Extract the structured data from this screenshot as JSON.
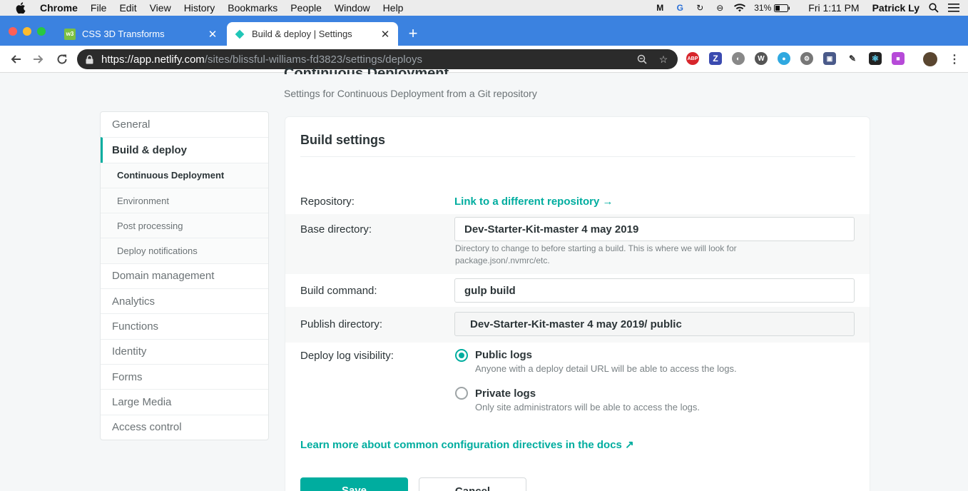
{
  "menubar": {
    "app": "Chrome",
    "items": [
      "File",
      "Edit",
      "View",
      "History",
      "Bookmarks",
      "People",
      "Window",
      "Help"
    ],
    "battery": "31%",
    "clock": "Fri 1:11 PM",
    "user": "Patrick Ly"
  },
  "tabs": [
    {
      "title": "CSS 3D Transforms"
    },
    {
      "title": "Build & deploy | Settings"
    }
  ],
  "address": {
    "scheme": "https://",
    "host": "app.netlify.com",
    "path": "/sites/blissful-williams-fd3823/settings/deploys"
  },
  "page": {
    "title": "Continuous Deployment",
    "subtitle": "Settings for Continuous Deployment from a Git repository"
  },
  "sidebar": {
    "items": [
      {
        "label": "General"
      },
      {
        "label": "Build & deploy"
      },
      {
        "label": "Continuous Deployment"
      },
      {
        "label": "Environment"
      },
      {
        "label": "Post processing"
      },
      {
        "label": "Deploy notifications"
      },
      {
        "label": "Domain management"
      },
      {
        "label": "Analytics"
      },
      {
        "label": "Functions"
      },
      {
        "label": "Identity"
      },
      {
        "label": "Forms"
      },
      {
        "label": "Large Media"
      },
      {
        "label": "Access control"
      }
    ]
  },
  "build": {
    "title": "Build settings",
    "repository_label": "Repository:",
    "repository_link": "Link to a different repository →",
    "base_label": "Base directory:",
    "base_value": "Dev-Starter-Kit-master 4 may 2019",
    "base_help": "Directory to change to before starting a build. This is where we will look for package.json/.nvmrc/etc.",
    "command_label": "Build command:",
    "command_value": "gulp build",
    "publish_label": "Publish directory:",
    "publish_value": "Dev-Starter-Kit-master 4 may 2019/  public",
    "visibility_label": "Deploy log visibility:",
    "public_title": "Public logs",
    "public_help": "Anyone with a deploy detail URL will be able to access the logs.",
    "private_title": "Private logs",
    "private_help": "Only site administrators will be able to access the logs.",
    "docs_link": "Learn more about common configuration directives in the docs ↗",
    "save": "Save",
    "cancel": "Cancel"
  },
  "colors": {
    "accent": "#00ad9f",
    "tabstrip": "#3b82e0"
  }
}
